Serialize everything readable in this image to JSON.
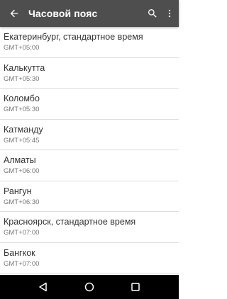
{
  "app_bar": {
    "title": "Часовой пояс",
    "back_icon": "arrow-back-icon",
    "search_icon": "search-icon",
    "more_icon": "more-vert-icon",
    "background": "#4e4e4e"
  },
  "timezones": [
    {
      "name": "Екатеринбург, стандартное время",
      "offset": "GMT+05:00"
    },
    {
      "name": "Калькутта",
      "offset": "GMT+05:30"
    },
    {
      "name": "Коломбо",
      "offset": "GMT+05:30"
    },
    {
      "name": "Катманду",
      "offset": "GMT+05:45"
    },
    {
      "name": "Алматы",
      "offset": "GMT+06:00"
    },
    {
      "name": "Рангун",
      "offset": "GMT+06:30"
    },
    {
      "name": "Красноярск, стандартное время",
      "offset": "GMT+07:00"
    },
    {
      "name": "Бангкок",
      "offset": "GMT+07:00"
    }
  ],
  "nav_bar": {
    "back_icon": "nav-back-icon",
    "home_icon": "nav-home-icon",
    "recents_icon": "nav-recents-icon",
    "background": "#000000"
  }
}
